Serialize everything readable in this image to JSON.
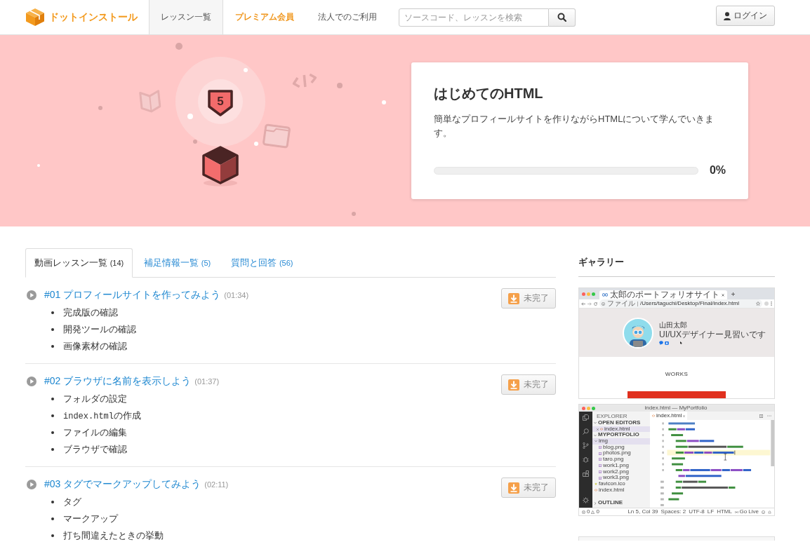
{
  "header": {
    "logo": "ドットインストール",
    "nav": [
      {
        "label": "レッスン一覧",
        "kind": "plain",
        "selected": true
      },
      {
        "label": "プレミアム会員",
        "kind": "premium",
        "selected": false
      },
      {
        "label": "法人でのご利用",
        "kind": "plain",
        "selected": false
      }
    ],
    "search": {
      "placeholder": "ソースコード、レッスンを検索"
    },
    "login": "ログイン"
  },
  "hero": {
    "badge": "5",
    "title": "はじめてのHTML",
    "description": "簡単なプロフィールサイトを作りながらHTMLについて学んでいきます。",
    "progress": {
      "level": 0,
      "reading": "0%"
    }
  },
  "tabs": [
    {
      "label": "動画レッスン一覧",
      "count": "(14)",
      "selected": true
    },
    {
      "label": "補足情報一覧",
      "count": "(5)",
      "selected": false
    },
    {
      "label": "質問と回答",
      "count": "(56)",
      "selected": false
    }
  ],
  "lessons": [
    {
      "title": "#01 プロフィールサイトを作ってみよう",
      "duration": "(01:34)",
      "status": "未完了",
      "topics": [
        {
          "text": "完成版の確認"
        },
        {
          "text": "開発ツールの確認"
        },
        {
          "text": "画像素材の確認"
        }
      ]
    },
    {
      "title": "#02 ブラウザに名前を表示しよう",
      "duration": "(01:37)",
      "status": "未完了",
      "topics": [
        {
          "text": "フォルダの設定"
        },
        {
          "code": "index.html",
          "text": "の作成"
        },
        {
          "text": "ファイルの編集"
        },
        {
          "text": "ブラウザで確認"
        }
      ]
    },
    {
      "title": "#03 タグでマークアップしてみよう",
      "duration": "(02:11)",
      "status": "未完了",
      "topics": [
        {
          "text": "タグ"
        },
        {
          "text": "マークアップ"
        },
        {
          "text": "打ち間違えたときの挙動"
        }
      ]
    }
  ],
  "gallery": {
    "title": "ギャラリー",
    "browser": {
      "tab_title": "太郎のポートフォリオサイト",
      "address_scheme": "ファイル",
      "address_path": "/Users/taguchi/Desktop/Final/index.html",
      "name": "山田太郎",
      "role": "UI/UXデザイナー見習いです",
      "section": "WORKS"
    },
    "editor": {
      "window_title": "index.html — MyPortfolio",
      "explorer": {
        "title": "EXPLORER",
        "sections": [
          {
            "label": "OPEN EDITORS",
            "expanded": true,
            "children": [
              {
                "label": "index.html",
                "kind": "html",
                "closable": true,
                "selected": true
              }
            ]
          },
          {
            "label": "MYPORTFOLIO",
            "expanded": true,
            "children": [
              {
                "label": "img",
                "kind": "folder",
                "expanded": true,
                "selected": true,
                "children": [
                  {
                    "label": "blog.png",
                    "kind": "image",
                    "selected": false
                  },
                  {
                    "label": "photos.png",
                    "kind": "image",
                    "selected": false
                  },
                  {
                    "label": "taro.png",
                    "kind": "image",
                    "selected": false
                  },
                  {
                    "label": "work1.png",
                    "kind": "image",
                    "selected": false
                  },
                  {
                    "label": "work2.png",
                    "kind": "image",
                    "selected": false
                  },
                  {
                    "label": "work3.png",
                    "kind": "image",
                    "selected": false
                  }
                ]
              },
              {
                "label": "favicon.ico",
                "kind": "favicon",
                "selected": false
              },
              {
                "label": "index.html",
                "kind": "html",
                "selected": false
              }
            ]
          },
          {
            "label": "OUTLINE",
            "expanded": false
          }
        ]
      },
      "tab": "index.html",
      "status": {
        "errors": "0",
        "warnings": "0",
        "items": [
          "Ln 5, Col 39",
          "Spaces: 2",
          "UTF-8",
          "LF",
          "HTML"
        ],
        "live": "Go Live"
      }
    }
  }
}
